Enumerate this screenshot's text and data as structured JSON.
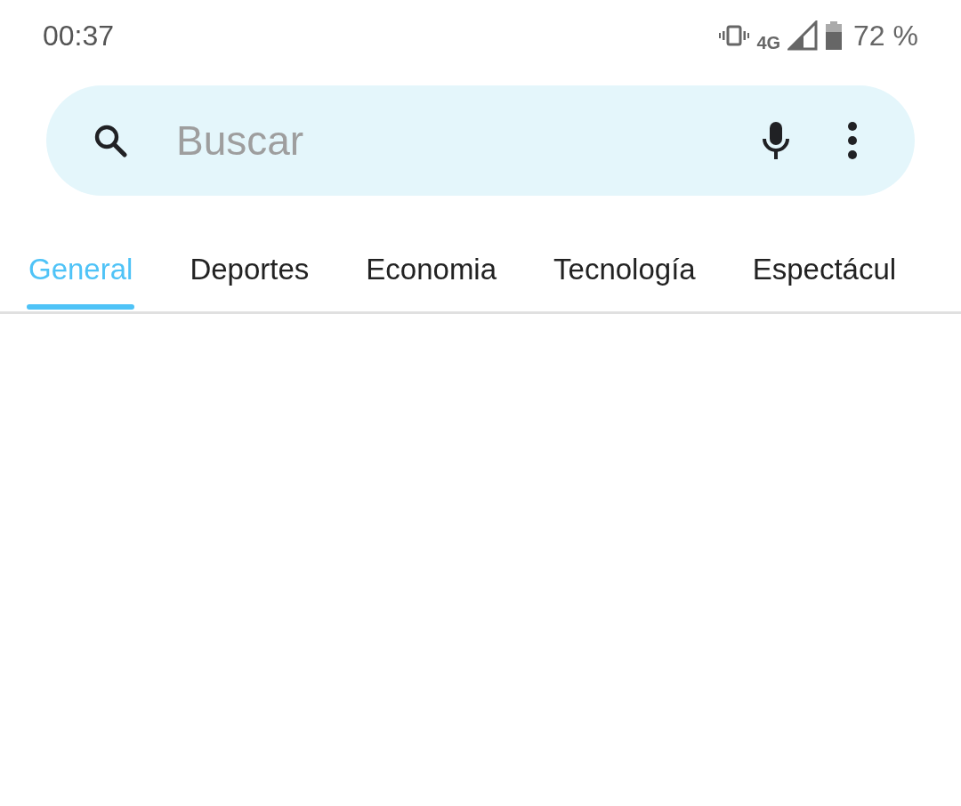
{
  "status_bar": {
    "time": "00:37",
    "network": "4G",
    "battery": "72 %"
  },
  "search": {
    "placeholder": "Buscar"
  },
  "tabs": [
    {
      "label": "General",
      "selected": true
    },
    {
      "label": "Deportes",
      "selected": false
    },
    {
      "label": "Economia",
      "selected": false
    },
    {
      "label": "Tecnología",
      "selected": false
    },
    {
      "label": "Espectácul",
      "selected": false
    }
  ]
}
